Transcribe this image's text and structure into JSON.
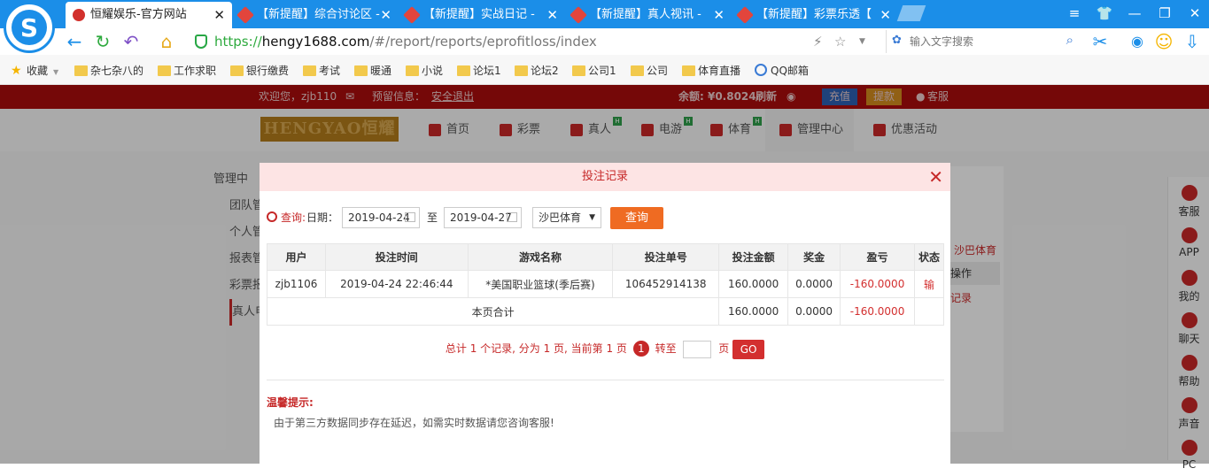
{
  "browser": {
    "tabs": [
      {
        "title": "恒耀娱乐-官方网站",
        "active": true
      },
      {
        "title": "【新提醒】综合讨论区 -"
      },
      {
        "title": "【新提醒】实战日记 -"
      },
      {
        "title": "【新提醒】真人视讯 -"
      },
      {
        "title": "【新提醒】彩票乐透【"
      }
    ],
    "url_scheme": "https://",
    "url_domain": "hengy1688.com",
    "url_path": "/#/report/reports/eprofitloss/index",
    "search_placeholder": "输入文字搜索",
    "bookmarks": [
      "收藏",
      "杂七杂八的",
      "工作求职",
      "银行缴费",
      "考试",
      "暖通",
      "小说",
      "论坛1",
      "论坛2",
      "公司1",
      "公司",
      "体育直播",
      "QQ邮箱"
    ]
  },
  "site": {
    "welcome": "欢迎您，zjb110",
    "notice": "预留信息：",
    "logout": "安全退出",
    "balance_label": "余额: ¥0.8024",
    "refresh": "刷新",
    "deposit": "充值",
    "withdraw": "提款",
    "service": "客服",
    "logo_text": "HENGYAO恒耀",
    "nav": [
      "首页",
      "彩票",
      "真人",
      "电游",
      "体育",
      "管理中心",
      "优惠活动"
    ],
    "nav_badge": "H",
    "sidebar": [
      "管理中",
      "团队管",
      "个人管",
      "报表管",
      "彩票报",
      "真人电"
    ],
    "right_text": [
      "沙巴体育",
      "操作",
      "记录"
    ],
    "float_bar": [
      "客服",
      "APP",
      "我的",
      "聊天",
      "帮助",
      "声音",
      "PC"
    ]
  },
  "modal": {
    "title": "投注记录",
    "query_label": "查询:",
    "date_label": "日期：",
    "date_from": "2019-04-24",
    "to_label": "至",
    "date_to": "2019-04-27",
    "game_select": "沙巴体育",
    "query_button": "查询",
    "columns": [
      "用户",
      "投注时间",
      "游戏名称",
      "投注单号",
      "投注金额",
      "奖金",
      "盈亏",
      "状态"
    ],
    "rows": [
      {
        "user": "zjb1106",
        "time": "2019-04-24 22:46:44",
        "game": "*美国职业篮球(季后赛)",
        "order": "106452914138",
        "amount": "160.0000",
        "bonus": "0.0000",
        "profit": "-160.0000",
        "status": "输"
      }
    ],
    "subtotal": {
      "label": "本页合计",
      "amount": "160.0000",
      "bonus": "0.0000",
      "profit": "-160.0000"
    },
    "pager": {
      "summary": "总计 1 个记录, 分为 1 页, 当前第 1 页",
      "current": "1",
      "goto_label": "转至",
      "page_unit": "页",
      "go": "GO"
    },
    "tip_title": "温馨提示:",
    "tip_body": "由于第三方数据同步存在延迟，如需实时数据请您咨询客服!"
  }
}
